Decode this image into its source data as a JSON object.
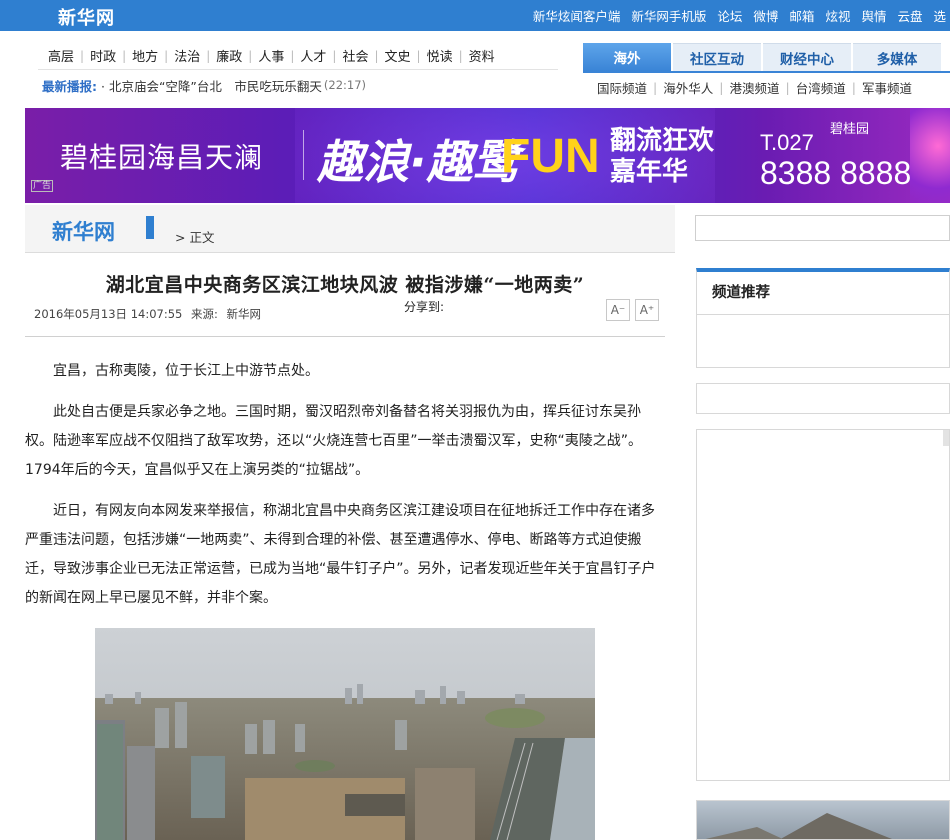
{
  "topbar": {
    "logo": "新华网",
    "links": [
      "新华炫闻客户端",
      "新华网手机版",
      "论坛",
      "微博",
      "邮箱",
      "炫视",
      "舆情",
      "云盘",
      "选"
    ]
  },
  "nav": {
    "categories": [
      "高层",
      "时政",
      "地方",
      "法治",
      "廉政",
      "人事",
      "人才",
      "社会",
      "文史",
      "悦读",
      "资料"
    ],
    "latest_label": "最新播报:",
    "latest_headline": "· 北京庙会“空降”台北　市民吃玩乐翻天",
    "latest_time": "(22:17)",
    "tabs": [
      "海外",
      "社区互动",
      "财经中心",
      "多媒体"
    ],
    "subchannels": [
      "国际频道",
      "海外华人",
      "港澳频道",
      "台湾频道",
      "军事频道"
    ]
  },
  "banner": {
    "brand": "碧桂园海昌天澜",
    "main_text": "趣浪·趣鹭",
    "fun_text": "FUN",
    "carnival_line1": "翻流狂欢",
    "carnival_line2": "嘉年华",
    "phone_line1": "T.027",
    "phone_line2": "8388 8888",
    "corp": "碧桂园",
    "ad_tag": "广告",
    "colors": {
      "accent": "#ffd21a",
      "background": "#5a1db8"
    }
  },
  "breadcrumb": {
    "logo": "新华网",
    "current": "> 正文"
  },
  "article": {
    "title": "湖北宜昌中央商务区滨江地块风波  被指涉嫌“一地两卖”",
    "date": "2016年05月13日 14:07:55",
    "source_label": "来源:",
    "source": "新华网",
    "share_label": "分享到:",
    "font_smaller": "A⁻",
    "font_larger": "A⁺",
    "paragraphs": [
      "宜昌，古称夷陵，位于长江上中游节点处。",
      "此处自古便是兵家必争之地。三国时期，蜀汉昭烈帝刘备替名将关羽报仇为由，挥兵征讨东吴孙权。陆逊率军应战不仅阻挡了敌军攻势，还以“火烧连营七百里”一举击溃蜀汉军，史称“夷陵之战”。1794年后的今天，宜昌似乎又在上演另类的“拉锯战”。",
      "近日，有网友向本网发来举报信，称湖北宜昌中央商务区滨江建设项目在征地拆迁工作中存在诸多严重违法问题，包括涉嫌“一地两卖”、未得到合理的补偿、甚至遭遇停水、停电、断路等方式迫使搬迁，导致涉事企业已无法正常运营，已成为当地“最牛钉子户”。另外，记者发现近些年关于宜昌钉子户的新闻在网上早已屡见不鲜，并非个案。"
    ]
  },
  "sidebar": {
    "recommend_title": "频道推荐"
  }
}
